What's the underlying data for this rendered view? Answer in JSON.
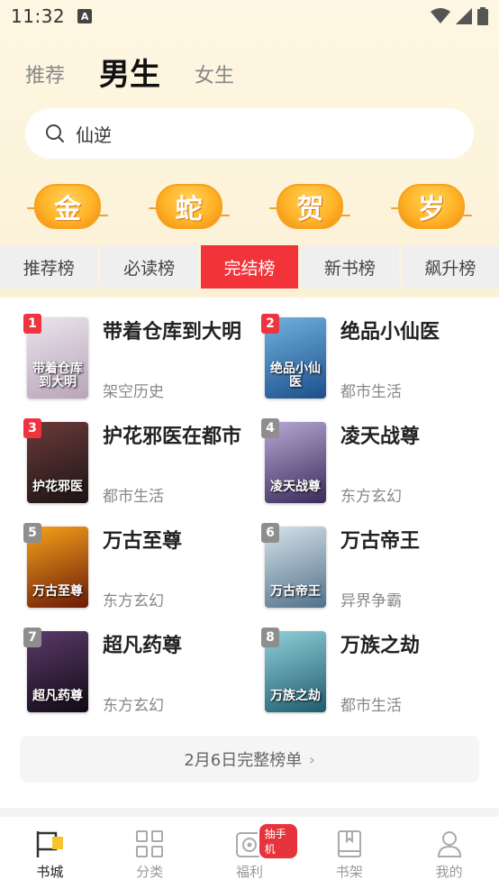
{
  "status": {
    "time": "11:32",
    "notif_letter": "A"
  },
  "top_tabs": [
    {
      "label": "推荐",
      "active": false
    },
    {
      "label": "男生",
      "active": true
    },
    {
      "label": "女生",
      "active": false
    }
  ],
  "search": {
    "value": "仙逆"
  },
  "festival": [
    "金",
    "蛇",
    "贺",
    "岁"
  ],
  "rank_tabs": [
    {
      "label": "推荐榜",
      "active": false
    },
    {
      "label": "必读榜",
      "active": false
    },
    {
      "label": "完结榜",
      "active": true
    },
    {
      "label": "新书榜",
      "active": false
    },
    {
      "label": "飙升榜",
      "active": false
    }
  ],
  "books": [
    {
      "rank": "1",
      "title": "带着仓库到大明",
      "genre": "架空历史",
      "cover_text": "带着仓库到大明",
      "cover_colors": [
        "#e9e4ec",
        "#b9a4b9"
      ]
    },
    {
      "rank": "2",
      "title": "绝品小仙医",
      "genre": "都市生活",
      "cover_text": "绝品小仙医",
      "cover_colors": [
        "#6fb2df",
        "#1d4f8a"
      ]
    },
    {
      "rank": "3",
      "title": "护花邪医在都市",
      "genre": "都市生活",
      "cover_text": "护花邪医",
      "cover_colors": [
        "#6b3a3a",
        "#1c1414"
      ]
    },
    {
      "rank": "4",
      "title": "凌天战尊",
      "genre": "东方玄幻",
      "cover_text": "凌天战尊",
      "cover_colors": [
        "#b6a8d4",
        "#3b2a5a"
      ]
    },
    {
      "rank": "5",
      "title": "万古至尊",
      "genre": "东方玄幻",
      "cover_text": "万古至尊",
      "cover_colors": [
        "#f5a21a",
        "#6a1a08"
      ]
    },
    {
      "rank": "6",
      "title": "万古帝王",
      "genre": "异界争霸",
      "cover_text": "万古帝王",
      "cover_colors": [
        "#d6e2ea",
        "#51718a"
      ]
    },
    {
      "rank": "7",
      "title": "超凡药尊",
      "genre": "东方玄幻",
      "cover_text": "超凡药尊",
      "cover_colors": [
        "#5a3a6a",
        "#120a14"
      ]
    },
    {
      "rank": "8",
      "title": "万族之劫",
      "genre": "都市生活",
      "cover_text": "万族之劫",
      "cover_colors": [
        "#8fd0d8",
        "#1f5b6e"
      ]
    }
  ],
  "full_list": {
    "label": "2月6日完整榜单",
    "chevron": "›"
  },
  "bottom_nav": [
    {
      "label": "书城",
      "icon": "flag-icon",
      "active": true
    },
    {
      "label": "分类",
      "icon": "grid-icon",
      "active": false
    },
    {
      "label": "福利",
      "icon": "gift-icon",
      "active": false,
      "badge": "抽手机"
    },
    {
      "label": "书架",
      "icon": "bookshelf-icon",
      "active": false
    },
    {
      "label": "我的",
      "icon": "person-icon",
      "active": false
    }
  ]
}
